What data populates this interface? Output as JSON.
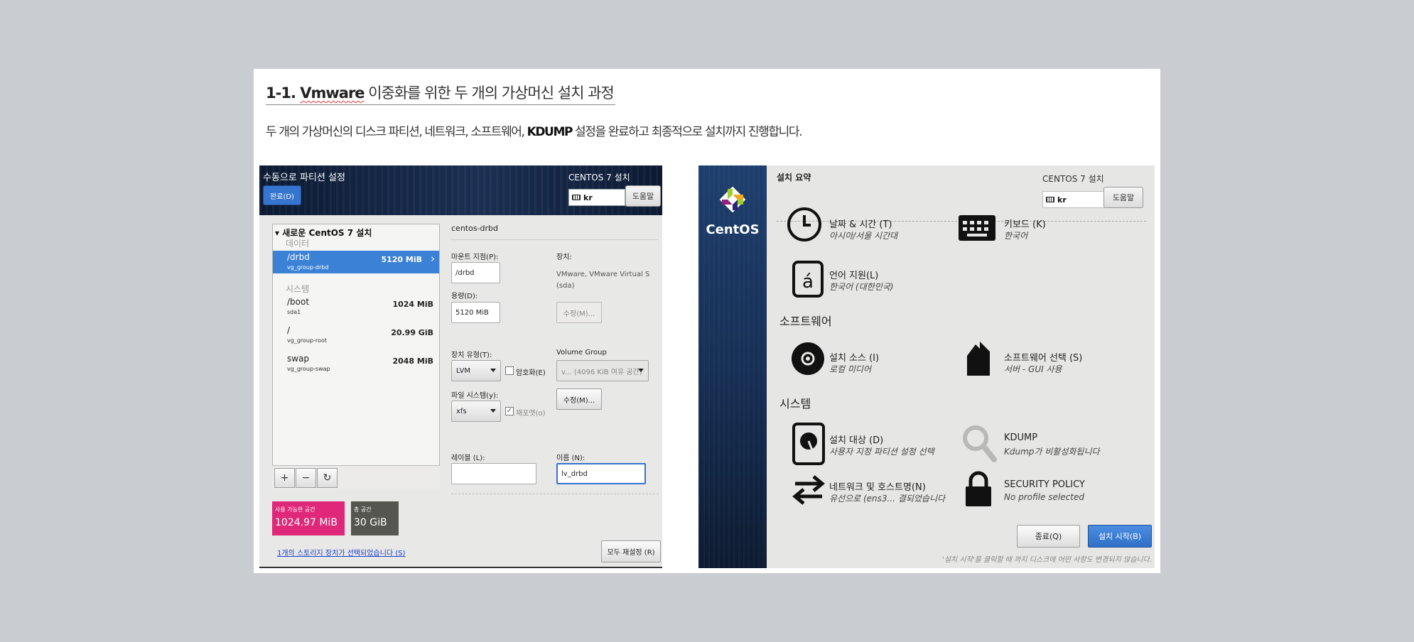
{
  "slide": {
    "title_prefix": "1-1. ",
    "title_vm": "Vmware",
    "title_suffix": " 이중화를 위한 두 개의 가상머신 설치 과정",
    "subtitle_part1": "두 개의 가상머신의 디스크 파티션, 네트워크, 소프트웨어, ",
    "subtitle_bold": "KDUMP",
    "subtitle_part2": " 설정을 완료하고 최종적으로 설치까지 진행합니다."
  },
  "left": {
    "header_title": "수동으로 파티션 설정",
    "done_label": "완료(D)",
    "install_title": "CENTOS 7 설치",
    "keyboard_value": "kr",
    "help_label": "도움말",
    "tree_root": "새로운 CentOS 7 설치",
    "category_data": "데이터",
    "category_system": "시스템",
    "mounts": [
      {
        "name": "/drbd",
        "device": "vg_group-drbd",
        "size": "5120 MiB"
      },
      {
        "name": "/boot",
        "device": "sda1",
        "size": "1024 MiB"
      },
      {
        "name": "/",
        "device": "vg_group-root",
        "size": "20.99 GiB"
      },
      {
        "name": "swap",
        "device": "vg_group-swap",
        "size": "2048 MiB"
      }
    ],
    "tools": {
      "add": "+",
      "remove": "−",
      "refresh": "↻"
    },
    "available_label": "사용 가능한 공간",
    "available_value": "1024.97 MiB",
    "total_label": "총 공간",
    "total_value": "30 GiB",
    "storage_link": "1개의 스토리지 장치가 선택되었습니다 (S)",
    "reset_label": "모두 재설정 (R)",
    "detail": {
      "title": "centos-drbd",
      "mount_label": "마운트 지점(P):",
      "mount_value": "/drbd",
      "device_label": "장치:",
      "device_value_line1": "VMware, VMware Virtual S",
      "device_value_line2": "(sda)",
      "capacity_label": "용량(D):",
      "capacity_value": "5120 MiB",
      "modify_disabled": "수정(M)...",
      "device_type_label": "장치 유형(T):",
      "device_type_value": "LVM",
      "encrypt_label": "암호화(E)",
      "volume_group_label": "Volume Group",
      "volume_group_value": "v...   (4096 KiB 여유 공간)",
      "modify_label": "수정(M)...",
      "fs_label": "파일 시스템(y):",
      "fs_value": "xfs",
      "reformat_label": "재포맷(o)",
      "reformat_check": "✓",
      "label_label": "레이블 (L):",
      "label_value": "",
      "name_label": "이름 (N):",
      "name_value": "lv_drbd"
    }
  },
  "right": {
    "summary_title": "설치 요약",
    "install_title": "CENTOS 7 설치",
    "keyboard_value": "kr",
    "help_label": "도움말",
    "brand": "CentOS",
    "spokes": {
      "datetime_title": "날짜 & 시간 (T)",
      "datetime_status": "아시아/서울 시간대",
      "keyboard_title": "키보드 (K)",
      "keyboard_status": "한국어",
      "language_title": "언어 지원(L)",
      "language_status": "한국어 (대한민국)",
      "source_title": "설치 소스 (I)",
      "source_status": "로컬 미디어",
      "software_title": "소프트웨어 선택 (S)",
      "software_status": "서버 - GUI 사용",
      "dest_title": "설치 대상 (D)",
      "dest_status": "사용자 지정 파티션 설정 선택",
      "kdump_title": "KDUMP",
      "kdump_status": "Kdump가 비활성화됩니다",
      "network_title": "네트워크 및 호스트명(N)",
      "network_status": "유선으로 (ens3... 결되었습니다",
      "security_title": "SECURITY POLICY",
      "security_status": "No profile selected"
    },
    "section_software": "소프트웨어",
    "section_system": "시스템",
    "quit_label": "종료(Q)",
    "begin_label": "설치 시작(B)",
    "note": "'설치 시작'을 클릭할 때 까지 디스크에 어떤 사항도 변경되지 않습니다."
  },
  "colors": {
    "accent": "#3574cf",
    "available": "#e0287a",
    "total": "#565650"
  }
}
